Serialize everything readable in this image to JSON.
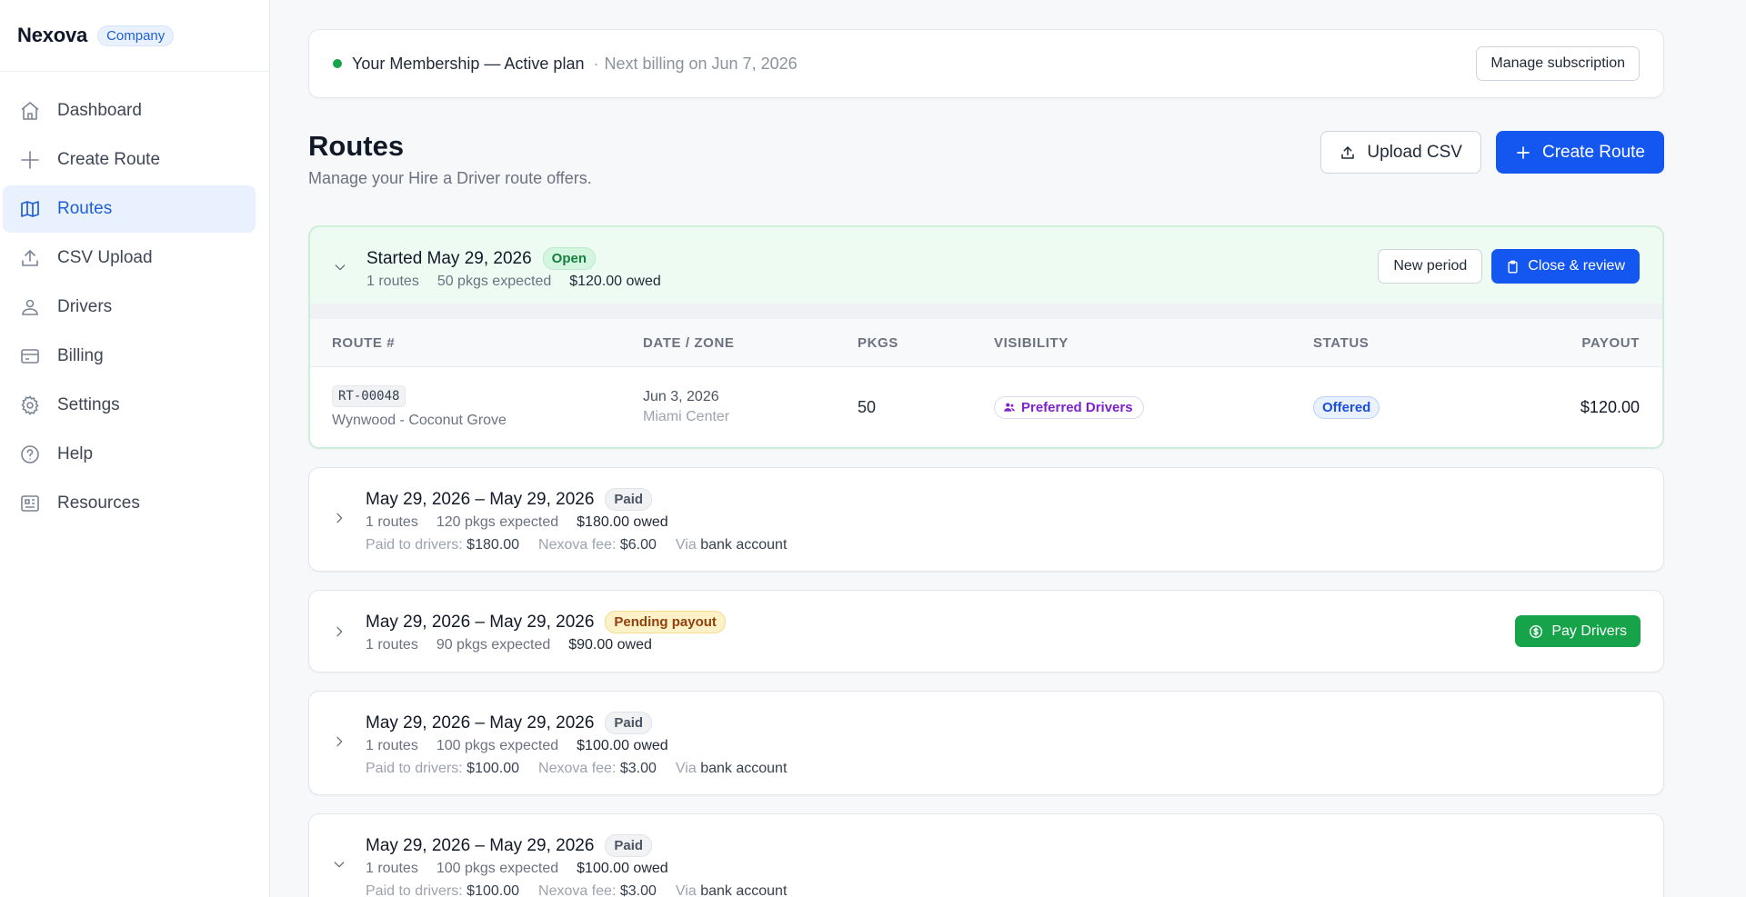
{
  "brand": {
    "name": "Nexova",
    "badge": "Company"
  },
  "sidebar": {
    "items": [
      {
        "label": "Dashboard",
        "icon": "home-icon",
        "active": false
      },
      {
        "label": "Create Route",
        "icon": "plus-icon",
        "active": false
      },
      {
        "label": "Routes",
        "icon": "map-icon",
        "active": true
      },
      {
        "label": "CSV Upload",
        "icon": "upload-icon",
        "active": false
      },
      {
        "label": "Drivers",
        "icon": "users-icon",
        "active": false
      },
      {
        "label": "Billing",
        "icon": "credit-card-icon",
        "active": false
      },
      {
        "label": "Settings",
        "icon": "gear-icon",
        "active": false
      },
      {
        "label": "Help",
        "icon": "help-circle-icon",
        "active": false
      },
      {
        "label": "Resources",
        "icon": "newspaper-icon",
        "active": false
      }
    ]
  },
  "membership": {
    "title": "Your Membership — Active plan",
    "separator": "·",
    "next_billing": "Next billing on Jun 7, 2026",
    "manage_label": "Manage subscription",
    "status_color": "#16a34a"
  },
  "page": {
    "title": "Routes",
    "subtitle": "Manage your Hire a Driver route offers.",
    "upload_label": "Upload CSV",
    "create_label": "Create Route"
  },
  "open_period": {
    "title": "Started May 29, 2026",
    "badge": "Open",
    "routes": "1 routes",
    "pkgs": "50 pkgs expected",
    "owed": "$120.00 owed",
    "new_period_label": "New period",
    "close_review_label": "Close & review",
    "table": {
      "headers": [
        "Route #",
        "Date / Zone",
        "Pkgs",
        "Visibility",
        "Status",
        "Payout"
      ],
      "rows": [
        {
          "route_number": "RT-00048",
          "area": "Wynwood - Coconut Grove",
          "date": "Jun 3, 2026",
          "zone": "Miami Center",
          "pkgs": "50",
          "visibility": "Preferred Drivers",
          "status": "Offered",
          "payout": "$120.00"
        }
      ]
    }
  },
  "periods": [
    {
      "title": "May 29, 2026 – May 29, 2026",
      "badge": "Paid",
      "routes": "1 routes",
      "pkgs": "120 pkgs expected",
      "owed": "$180.00 owed",
      "paid_label": "Paid to drivers:",
      "paid_value": "$180.00",
      "fee_label": "Nexova fee:",
      "fee_value": "$6.00",
      "via_label": "Via",
      "via_value": "bank account"
    },
    {
      "title": "May 29, 2026 – May 29, 2026",
      "badge": "Pending payout",
      "routes": "1 routes",
      "pkgs": "90 pkgs expected",
      "owed": "$90.00 owed",
      "pay_label": "Pay Drivers"
    },
    {
      "title": "May 29, 2026 – May 29, 2026",
      "badge": "Paid",
      "routes": "1 routes",
      "pkgs": "100 pkgs expected",
      "owed": "$100.00 owed",
      "paid_label": "Paid to drivers:",
      "paid_value": "$100.00",
      "fee_label": "Nexova fee:",
      "fee_value": "$3.00",
      "via_label": "Via",
      "via_value": "bank account"
    },
    {
      "title": "May 29, 2026 – May 29, 2026",
      "badge": "Paid",
      "routes": "1 routes",
      "pkgs": "100 pkgs expected",
      "owed": "$100.00 owed",
      "paid_label": "Paid to drivers:",
      "paid_value": "$100.00",
      "fee_label": "Nexova fee:",
      "fee_value": "$3.00",
      "via_label": "Via",
      "via_value": "bank account"
    }
  ],
  "colors": {
    "accent": "#1456f0",
    "success": "#16a34a",
    "active_nav_bg": "#eaf1fe"
  }
}
